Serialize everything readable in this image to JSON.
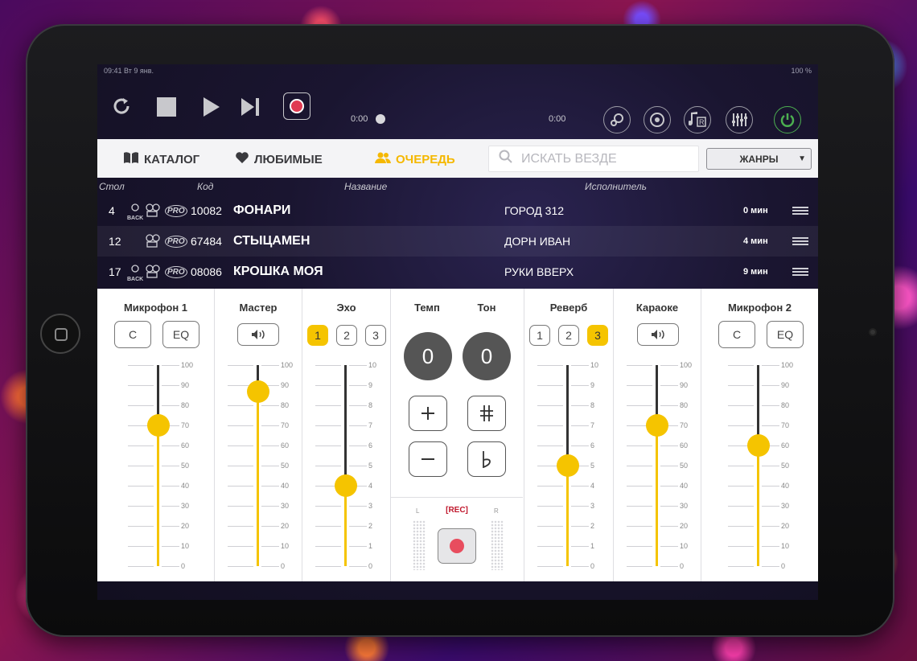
{
  "status": {
    "left": "09:41  Вт 9 янв.",
    "right": "100 %"
  },
  "transport": {
    "time_left": "0:00",
    "time_right": "0:00"
  },
  "nav": {
    "catalog": "КАТАЛОГ",
    "favorites": "ЛЮБИМЫЕ",
    "queue": "ОЧЕРЕДЬ",
    "search_placeholder": "ИСКАТЬ ВЕЗДЕ",
    "genres": "ЖАНРЫ"
  },
  "columns": {
    "table": "Стол",
    "code": "Код",
    "title": "Название",
    "artist": "Исполнитель"
  },
  "queue": [
    {
      "table": "4",
      "back": true,
      "code": "10082",
      "title": "ФОНАРИ",
      "artist": "ГОРОД 312",
      "wait": "0 мин"
    },
    {
      "table": "12",
      "back": false,
      "code": "67484",
      "title": "СТЫЦАМЕН",
      "artist": "ДОРН ИВАН",
      "wait": "4 мин"
    },
    {
      "table": "17",
      "back": true,
      "code": "08086",
      "title": "КРОШКА МОЯ",
      "artist": "РУКИ ВВЕРХ",
      "wait": "9 мин"
    }
  ],
  "row_icons": {
    "back": "BACK",
    "pro": "PRO"
  },
  "mixer": {
    "mic1": {
      "label": "Микрофон 1",
      "btn_c": "C",
      "btn_eq": "EQ",
      "value": 70,
      "max": 100,
      "ticks": [
        "100",
        "90",
        "80",
        "70",
        "60",
        "50",
        "40",
        "30",
        "20",
        "10",
        "0"
      ]
    },
    "master": {
      "label": "Мастер",
      "value": 87,
      "max": 100,
      "ticks": [
        "100",
        "90",
        "80",
        "70",
        "60",
        "50",
        "40",
        "30",
        "20",
        "10",
        "0"
      ]
    },
    "echo": {
      "label": "Эхо",
      "presets": [
        "1",
        "2",
        "3"
      ],
      "active": 0,
      "value": 4,
      "max": 10,
      "ticks": [
        "10",
        "9",
        "8",
        "7",
        "6",
        "5",
        "4",
        "3",
        "2",
        "1",
        "0"
      ]
    },
    "tempo": {
      "label": "Темп",
      "value": "0"
    },
    "tone": {
      "label": "Тон",
      "value": "0"
    },
    "rec": {
      "label": "[REC]",
      "l": "L",
      "r": "R"
    },
    "reverb": {
      "label": "Реверб",
      "presets": [
        "1",
        "2",
        "3"
      ],
      "active": 2,
      "value": 5,
      "max": 10,
      "ticks": [
        "10",
        "9",
        "8",
        "7",
        "6",
        "5",
        "4",
        "3",
        "2",
        "1",
        "0"
      ]
    },
    "karaoke": {
      "label": "Караоке",
      "value": 70,
      "max": 100,
      "ticks": [
        "100",
        "90",
        "80",
        "70",
        "60",
        "50",
        "40",
        "30",
        "20",
        "10",
        "0"
      ]
    },
    "mic2": {
      "label": "Микрофон 2",
      "btn_c": "C",
      "btn_eq": "EQ",
      "value": 60,
      "max": 100,
      "ticks": [
        "100",
        "90",
        "80",
        "70",
        "60",
        "50",
        "40",
        "30",
        "20",
        "10",
        "0"
      ]
    }
  },
  "colors": {
    "accent": "#f5c400",
    "active_tab": "#f5b800",
    "rec_red": "#c0182d"
  }
}
